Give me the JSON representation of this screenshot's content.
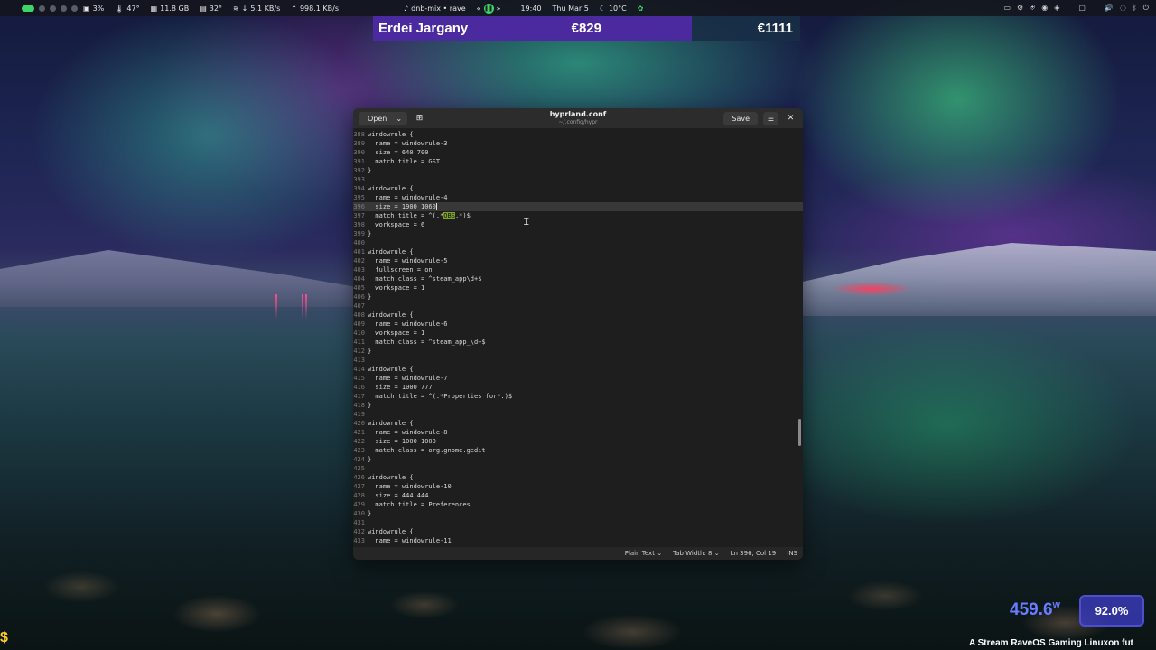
{
  "topbar": {
    "cpu": "3%",
    "temp": "47°",
    "mem": "11.8 GB",
    "gpu_temp": "32°",
    "down": "5.1 KB/s",
    "up": "998.1 KB/s",
    "media": "dnb-mix • rave",
    "time": "19:40",
    "date": "Thu Mar 5",
    "weather": "10°C"
  },
  "donation": {
    "name": "Erdei Jargany",
    "amount": "€829",
    "goal": "€1111"
  },
  "editor": {
    "open_label": "Open",
    "title": "hyprland.conf",
    "subtitle": "~/.config/hypr",
    "save_label": "Save",
    "lines": [
      {
        "n": "388",
        "t": "windowrule {"
      },
      {
        "n": "389",
        "t": "  name = windowrule-3"
      },
      {
        "n": "390",
        "t": "  size = 640 700"
      },
      {
        "n": "391",
        "t": "  match:title = GST"
      },
      {
        "n": "392",
        "t": "}"
      },
      {
        "n": "393",
        "t": ""
      },
      {
        "n": "394",
        "t": "windowrule {"
      },
      {
        "n": "395",
        "t": "  name = windowrule-4"
      },
      {
        "n": "396",
        "t": "  size = 1900 1060"
      },
      {
        "n": "397",
        "t": "  match:title = ^(.*OBS.*)$"
      },
      {
        "n": "398",
        "t": "  workspace = 6"
      },
      {
        "n": "399",
        "t": "}"
      },
      {
        "n": "400",
        "t": ""
      },
      {
        "n": "401",
        "t": "windowrule {"
      },
      {
        "n": "402",
        "t": "  name = windowrule-5"
      },
      {
        "n": "403",
        "t": "  fullscreen = on"
      },
      {
        "n": "404",
        "t": "  match:class = ^steam_app\\d+$"
      },
      {
        "n": "405",
        "t": "  workspace = 1"
      },
      {
        "n": "406",
        "t": "}"
      },
      {
        "n": "407",
        "t": ""
      },
      {
        "n": "408",
        "t": "windowrule {"
      },
      {
        "n": "409",
        "t": "  name = windowrule-6"
      },
      {
        "n": "410",
        "t": "  workspace = 1"
      },
      {
        "n": "411",
        "t": "  match:class = ^steam_app_\\d+$"
      },
      {
        "n": "412",
        "t": "}"
      },
      {
        "n": "413",
        "t": ""
      },
      {
        "n": "414",
        "t": "windowrule {"
      },
      {
        "n": "415",
        "t": "  name = windowrule-7"
      },
      {
        "n": "416",
        "t": "  size = 1000 777"
      },
      {
        "n": "417",
        "t": "  match:title = ^(.*Properties for*.)$"
      },
      {
        "n": "418",
        "t": "}"
      },
      {
        "n": "419",
        "t": ""
      },
      {
        "n": "420",
        "t": "windowrule {"
      },
      {
        "n": "421",
        "t": "  name = windowrule-8"
      },
      {
        "n": "422",
        "t": "  size = 1000 1000"
      },
      {
        "n": "423",
        "t": "  match:class = org.gnome.gedit"
      },
      {
        "n": "424",
        "t": "}"
      },
      {
        "n": "425",
        "t": ""
      },
      {
        "n": "426",
        "t": "windowrule {"
      },
      {
        "n": "427",
        "t": "  name = windowrule-10"
      },
      {
        "n": "428",
        "t": "  size = 444 444"
      },
      {
        "n": "429",
        "t": "  match:title = Preferences"
      },
      {
        "n": "430",
        "t": "}"
      },
      {
        "n": "431",
        "t": ""
      },
      {
        "n": "432",
        "t": "windowrule {"
      },
      {
        "n": "433",
        "t": "  name = windowrule-11"
      }
    ],
    "current_line_number": "396",
    "current_line_prefix": "  size = 1900 1060",
    "highlight_line_number": "397",
    "highlight_before": "  match:title = ^(.*",
    "highlight_word": "OBS",
    "highlight_after": ".*)$"
  },
  "statusbar": {
    "language": "Plain Text",
    "tab_width": "Tab Width: 8",
    "position": "Ln 396, Col 19",
    "mode": "INS"
  },
  "overlay": {
    "watts": "459.6",
    "watts_unit": "W",
    "percent": "92.0%",
    "ticker": "A Stream RaveOS Gaming Linuxon fut",
    "dollar": "$"
  }
}
